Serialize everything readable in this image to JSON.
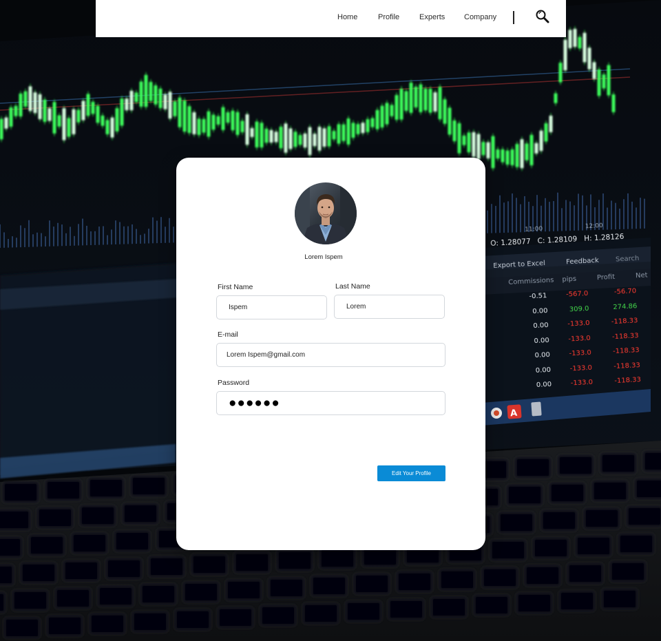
{
  "header": {
    "nav": [
      "Home",
      "Profile",
      "Experts",
      "Company"
    ],
    "search_icon": "search-icon"
  },
  "profile": {
    "display_name": "Lorem Ispem",
    "avatar_icon": "avatar-photo"
  },
  "form": {
    "first_name": {
      "label": "First Name",
      "value": "Ispem"
    },
    "last_name": {
      "label": "Last Name",
      "value": "Lorem"
    },
    "email": {
      "label": "E-mail",
      "value": "Lorem Ispem@gmail.com"
    },
    "password": {
      "label": "Password",
      "value": "●●●●●●"
    },
    "submit_label": "Edit Your Profile"
  },
  "background": {
    "price_readout": [
      "O: 1.28077",
      "C: 1.28109",
      "H: 1.28126"
    ],
    "time_ticks": [
      "11:00",
      "12:00"
    ],
    "toolbar": [
      "Export to Excel",
      "Feedback",
      "Search"
    ],
    "table_headers": [
      "Commissions",
      "pips",
      "Profit",
      "Net"
    ],
    "table_rows": [
      [
        "-0.51",
        "-567.0",
        "-56.70"
      ],
      [
        "0.00",
        "309.0",
        "274.86"
      ],
      [
        "0.00",
        "-133.0",
        "-118.33"
      ],
      [
        "0.00",
        "-133.0",
        "-118.33"
      ],
      [
        "0.00",
        "-133.0",
        "-118.33"
      ],
      [
        "0.00",
        "-133.0",
        "-118.33"
      ],
      [
        "0.00",
        "-133.0",
        "-118.33"
      ]
    ]
  },
  "colors": {
    "accent": "#0a8bd6",
    "candle_green": "#2ee04a",
    "loss_red": "#ff3b30",
    "gain_green": "#43d64a"
  }
}
